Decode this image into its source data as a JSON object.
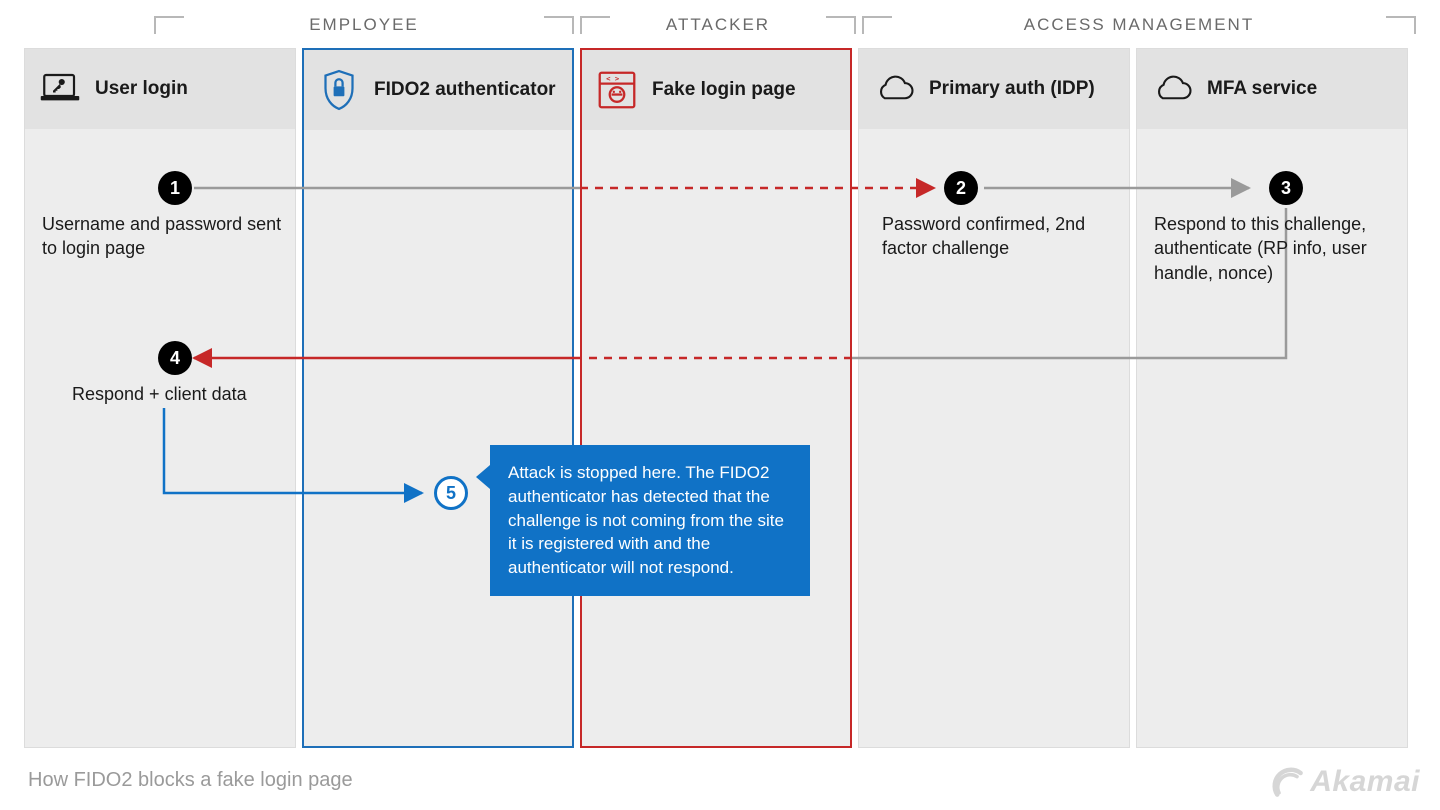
{
  "groups": {
    "employee": "EMPLOYEE",
    "attacker": "ATTACKER",
    "access": "ACCESS MANAGEMENT"
  },
  "columns": {
    "c1": "User login",
    "c2": "FIDO2 authenticator",
    "c3": "Fake login page",
    "c4": "Primary auth (IDP)",
    "c5": "MFA service"
  },
  "steps": {
    "s1": {
      "num": "1",
      "text": "Username and password sent to login page"
    },
    "s2": {
      "num": "2",
      "text": "Password confirmed, 2nd factor challenge"
    },
    "s3": {
      "num": "3",
      "text": "Respond to this challenge, authenticate (RP info, user handle, nonce)"
    },
    "s4": {
      "num": "4",
      "text": "Respond + client data"
    },
    "s5": {
      "num": "5",
      "text": "Attack is stopped here. The FIDO2 authenticator has detected that the challenge is not coming from the site it is registered with and the authenticator will not respond."
    }
  },
  "caption": "How FIDO2 blocks a fake login page",
  "brand": "Akamai",
  "colors": {
    "blue": "#1072c6",
    "red": "#c62828",
    "gray": "#9a9a9a"
  }
}
